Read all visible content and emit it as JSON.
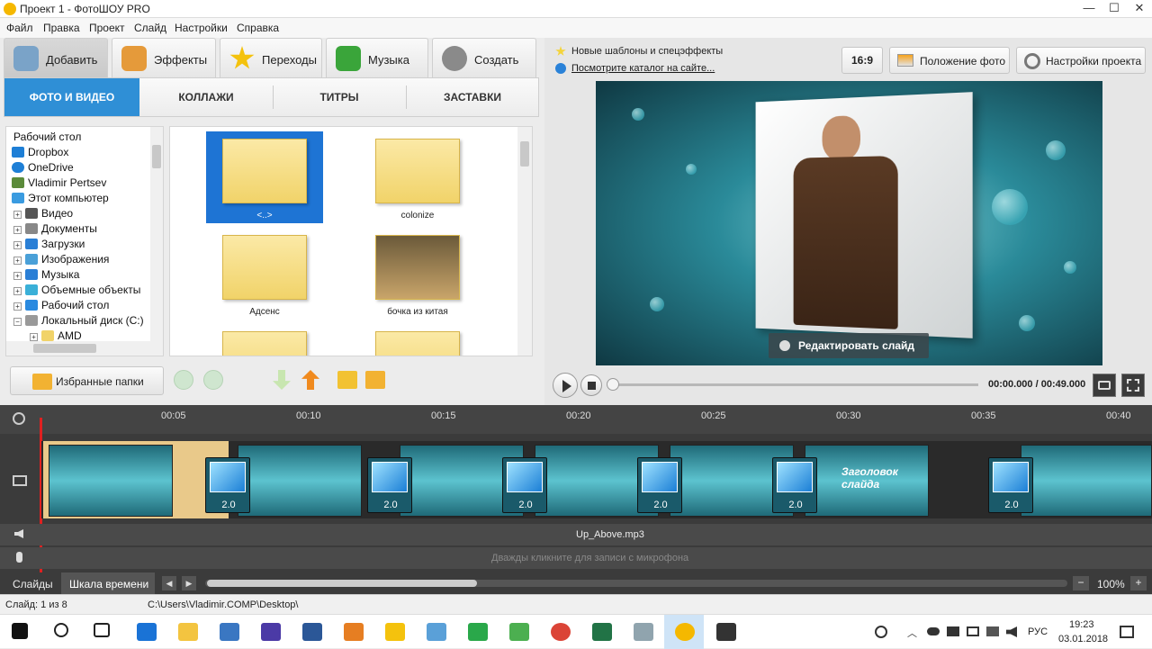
{
  "window": {
    "title": "Проект 1 - ФотоШОУ PRO"
  },
  "menu": [
    "Файл",
    "Правка",
    "Проект",
    "Слайд",
    "Настройки",
    "Справка"
  ],
  "main_tabs": [
    {
      "label": "Добавить",
      "icon": "camera-icon",
      "color": "#7aa3c8"
    },
    {
      "label": "Эффекты",
      "icon": "palette-icon",
      "color": "#e59a3a"
    },
    {
      "label": "Переходы",
      "icon": "star-icon",
      "color": "#f4c20d"
    },
    {
      "label": "Музыка",
      "icon": "music-note-icon",
      "color": "#3aa53a"
    },
    {
      "label": "Создать",
      "icon": "film-reel-icon",
      "color": "#8a8a8a"
    }
  ],
  "sub_tabs": [
    "ФОТО И ВИДЕО",
    "КОЛЛАЖИ",
    "ТИТРЫ",
    "ЗАСТАВКИ"
  ],
  "tree": [
    {
      "label": "Рабочий стол",
      "expander": "",
      "icon": "",
      "color": ""
    },
    {
      "label": "Dropbox",
      "expander": "",
      "icon": "dropbox-icon",
      "color": "#1e7fd6"
    },
    {
      "label": "OneDrive",
      "expander": "",
      "icon": "cloud-icon",
      "color": "#1e7fd6"
    },
    {
      "label": "Vladimir Pertsev",
      "expander": "",
      "icon": "user-icon",
      "color": "#5b8b3a"
    },
    {
      "label": "Этот компьютер",
      "expander": "",
      "icon": "computer-icon",
      "color": "#3a9be0"
    },
    {
      "label": "Видео",
      "expander": "+",
      "icon": "video-icon",
      "color": "#555"
    },
    {
      "label": "Документы",
      "expander": "+",
      "icon": "document-icon",
      "color": "#888"
    },
    {
      "label": "Загрузки",
      "expander": "+",
      "icon": "download-icon",
      "color": "#2a7fd6"
    },
    {
      "label": "Изображения",
      "expander": "+",
      "icon": "image-icon",
      "color": "#4aa0d8"
    },
    {
      "label": "Музыка",
      "expander": "+",
      "icon": "music-icon",
      "color": "#2a7fd6"
    },
    {
      "label": "Объемные объекты",
      "expander": "+",
      "icon": "cube-icon",
      "color": "#3ab0d8"
    },
    {
      "label": "Рабочий стол",
      "expander": "+",
      "icon": "desktop-icon",
      "color": "#2a8ae0"
    },
    {
      "label": "Локальный диск (C:)",
      "expander": "−",
      "icon": "disk-icon",
      "color": "#999"
    },
    {
      "label": "AMD",
      "expander": "+",
      "icon": "folder-icon",
      "color": "#f1d369"
    }
  ],
  "files": [
    "<..>",
    "colonize",
    "Адсенс",
    "бочка из китая",
    "",
    ""
  ],
  "favorites_button": "Избранные папки",
  "news": {
    "line1": "Новые шаблоны и спецэффекты",
    "line2": "Посмотрите каталог на сайте..."
  },
  "preview_buttons": {
    "ratio": "16:9",
    "photo_pos": "Положение фото",
    "settings": "Настройки проекта"
  },
  "edit_slide": "Редактировать слайд",
  "player": {
    "time": "00:00.000 / 00:49.000"
  },
  "timeline": {
    "ticks": [
      "00:05",
      "00:10",
      "00:15",
      "00:20",
      "00:25",
      "00:30",
      "00:35",
      "00:40"
    ],
    "transitions": [
      "2.0",
      "2.0",
      "2.0",
      "2.0",
      "2.0",
      "2.0"
    ],
    "clip_text": "Заголовок слайда",
    "audio": "Up_Above.mp3",
    "mic_hint": "Дважды кликните для записи с микрофона"
  },
  "view_tabs": [
    "Слайды",
    "Шкала времени"
  ],
  "zoom": "100%",
  "status": {
    "slide": "Слайд: 1 из 8",
    "path": "C:\\Users\\Vladimir.COMP\\Desktop\\"
  },
  "tray": {
    "lang": "РУС",
    "time": "19:23",
    "date": "03.01.2018"
  }
}
